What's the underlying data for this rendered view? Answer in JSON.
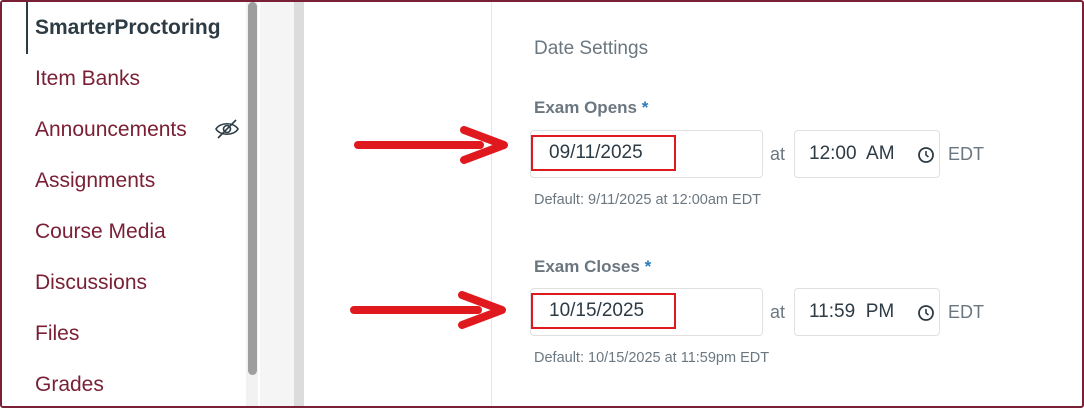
{
  "sidebar": {
    "items": [
      {
        "label": "SmarterProctoring",
        "active": true
      },
      {
        "label": "Item Banks"
      },
      {
        "label": "Announcements",
        "icon": "eye-slash-icon"
      },
      {
        "label": "Assignments"
      },
      {
        "label": "Course Media"
      },
      {
        "label": "Discussions"
      },
      {
        "label": "Files"
      },
      {
        "label": "Grades"
      }
    ]
  },
  "date_settings": {
    "title": "Date Settings",
    "required_marker": "*",
    "at_label": "at",
    "exam_opens": {
      "label": "Exam Opens",
      "date": "09/11/2025",
      "time": "12:00  AM",
      "timezone": "EDT",
      "default_text": "Default: 9/11/2025 at 12:00am EDT"
    },
    "exam_closes": {
      "label": "Exam Closes",
      "date": "10/15/2025",
      "time": "11:59  PM",
      "timezone": "EDT",
      "default_text": "Default: 10/15/2025 at 11:59pm EDT"
    }
  },
  "colors": {
    "nav_link": "#7a2036",
    "active_nav": "#2d3b45",
    "required": "#2a7abf",
    "annotation": "#e0191e"
  }
}
